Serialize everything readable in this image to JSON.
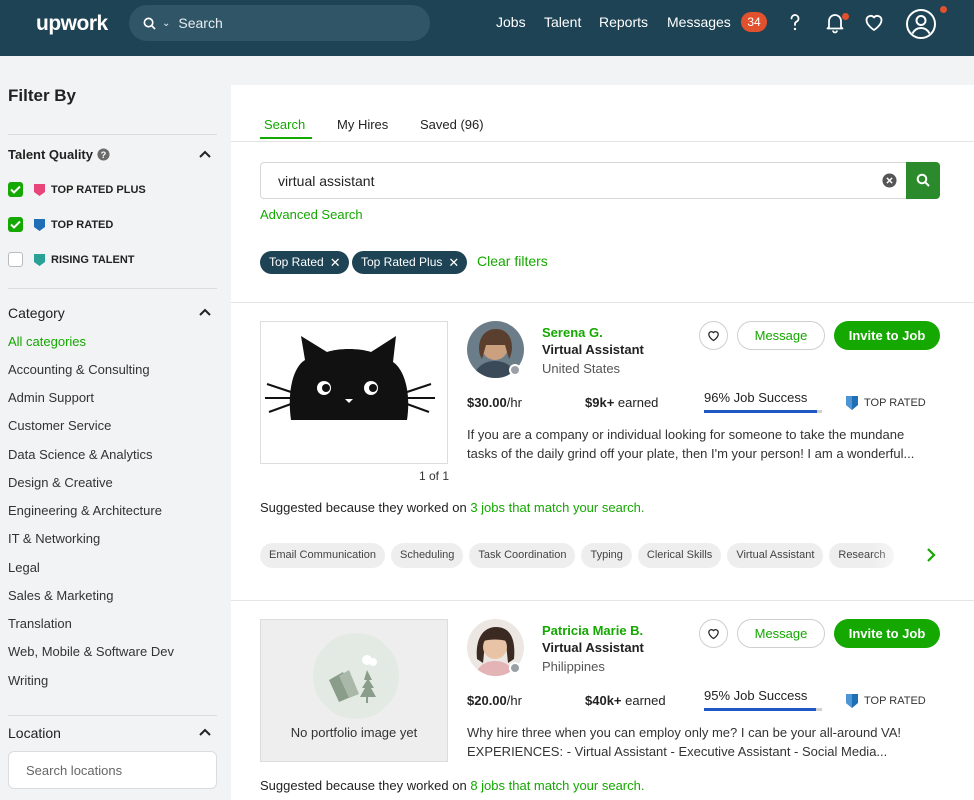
{
  "header": {
    "logo": "upwork",
    "search_label": "Search",
    "nav": [
      "Jobs",
      "Talent",
      "Reports",
      "Messages"
    ],
    "messages_count": "34",
    "icons": [
      "help-icon",
      "bell-icon",
      "heart-icon",
      "user-icon"
    ]
  },
  "sidebar": {
    "title": "Filter By",
    "talent_quality": {
      "title": "Talent Quality",
      "options": [
        {
          "label": "TOP RATED PLUS",
          "checked": true,
          "color": "#e8457a"
        },
        {
          "label": "TOP RATED",
          "checked": true,
          "color": "#1f6fb5"
        },
        {
          "label": "RISING TALENT",
          "checked": false,
          "color": "#2aa197"
        }
      ]
    },
    "category": {
      "title": "Category",
      "items": [
        "All categories",
        "Accounting & Consulting",
        "Admin Support",
        "Customer Service",
        "Data Science & Analytics",
        "Design & Creative",
        "Engineering & Architecture",
        "IT & Networking",
        "Legal",
        "Sales & Marketing",
        "Translation",
        "Web, Mobile & Software Dev",
        "Writing"
      ]
    },
    "location": {
      "title": "Location",
      "placeholder": "Search locations"
    }
  },
  "main": {
    "tabs": [
      "Search",
      "My Hires",
      "Saved (96)"
    ],
    "search_value": "virtual assistant",
    "advanced_search": "Advanced Search",
    "chips": [
      "Top Rated",
      "Top Rated Plus"
    ],
    "clear_filters": "Clear filters"
  },
  "freelancers": [
    {
      "name": "Serena G.",
      "title": "Virtual Assistant",
      "location": "United States",
      "rate": "$30.00",
      "rate_unit": "/hr",
      "earned": "$9k+",
      "earned_label": "earned",
      "job_success": "96% Job Success",
      "job_success_pct": 96,
      "badge": "TOP RATED",
      "message_label": "Message",
      "invite_label": "Invite to Job",
      "portfolio_count": "1 of 1",
      "bio_line1": "If you are a company or individual looking for someone to take the mundane",
      "bio_line2": "tasks of the daily grind off your plate, then I'm your person! I am a wonderful...",
      "suggest_prefix": "Suggested because they worked on",
      "suggest_link": "3 jobs that match your search.",
      "skills": [
        "Email Communication",
        "Scheduling",
        "Task Coordination",
        "Typing",
        "Clerical Skills",
        "Virtual Assistant",
        "Research"
      ]
    },
    {
      "name": "Patricia Marie B.",
      "title": "Virtual Assistant",
      "location": "Philippines",
      "rate": "$20.00",
      "rate_unit": "/hr",
      "earned": "$40k+",
      "earned_label": "earned",
      "job_success": "95% Job Success",
      "job_success_pct": 95,
      "badge": "TOP RATED",
      "message_label": "Message",
      "invite_label": "Invite to Job",
      "no_portfolio": "No portfolio image yet",
      "bio_line1": "Why hire three when you can employ only me? I can be your all-around VA!",
      "bio_line2": "EXPERIENCES: - Virtual Assistant - Executive Assistant - Social Media...",
      "suggest_prefix": "Suggested because they worked on",
      "suggest_link": "8 jobs that match your search."
    }
  ]
}
